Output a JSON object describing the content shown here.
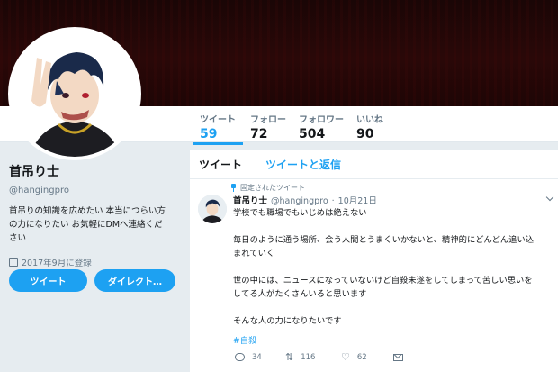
{
  "profile": {
    "name": "首吊り士",
    "handle": "@hangingpro",
    "bio_line1": "首吊りの知識を広めたい 本当につらい方",
    "bio_line2": "の力になりたい お気軽にDMへ連絡くだ",
    "bio_line3": "さい",
    "joined": "2017年9月に登録",
    "tweet_button": "ツイート",
    "dm_button": "ダイレクト…"
  },
  "stats": {
    "tweets_label": "ツイート",
    "tweets_count": "59",
    "following_label": "フォロー",
    "following_count": "72",
    "followers_label": "フォロワー",
    "followers_count": "504",
    "likes_label": "いいね",
    "likes_count": "90"
  },
  "timeline": {
    "tab_tweets": "ツイート",
    "tab_replies": "ツイートと返信"
  },
  "tweet": {
    "pinned_label": "固定されたツイート",
    "name": "首吊り士",
    "handle": "@hangingpro",
    "dot": "·",
    "date": "10月21日",
    "line1": "学校でも職場でもいじめは絶えない",
    "para2_line1": "毎日のように通う場所、会う人間とうまくいかないと、精神的にどんどん追い込",
    "para2_line2": "まれていく",
    "para3_line1": "世の中には、ニュースになっていないけど自殺未遂をしてしまって苦しい思いを",
    "para3_line2": "してる人がたくさんいると思います",
    "para4": "そんな人の力になりたいです",
    "hashtag": "#自殺",
    "replies": "34",
    "retweets": "116",
    "likes": "62"
  },
  "icons": {
    "pin": "pin-icon",
    "calendar": "calendar-icon",
    "reply": "reply-icon",
    "retweet": "retweet-icon",
    "like": "heart-icon",
    "dm": "envelope-icon",
    "caret": "chevron-down-icon"
  },
  "colors": {
    "accent": "#1da1f2",
    "banner": "#2a0808",
    "background": "#e6ecf0"
  }
}
